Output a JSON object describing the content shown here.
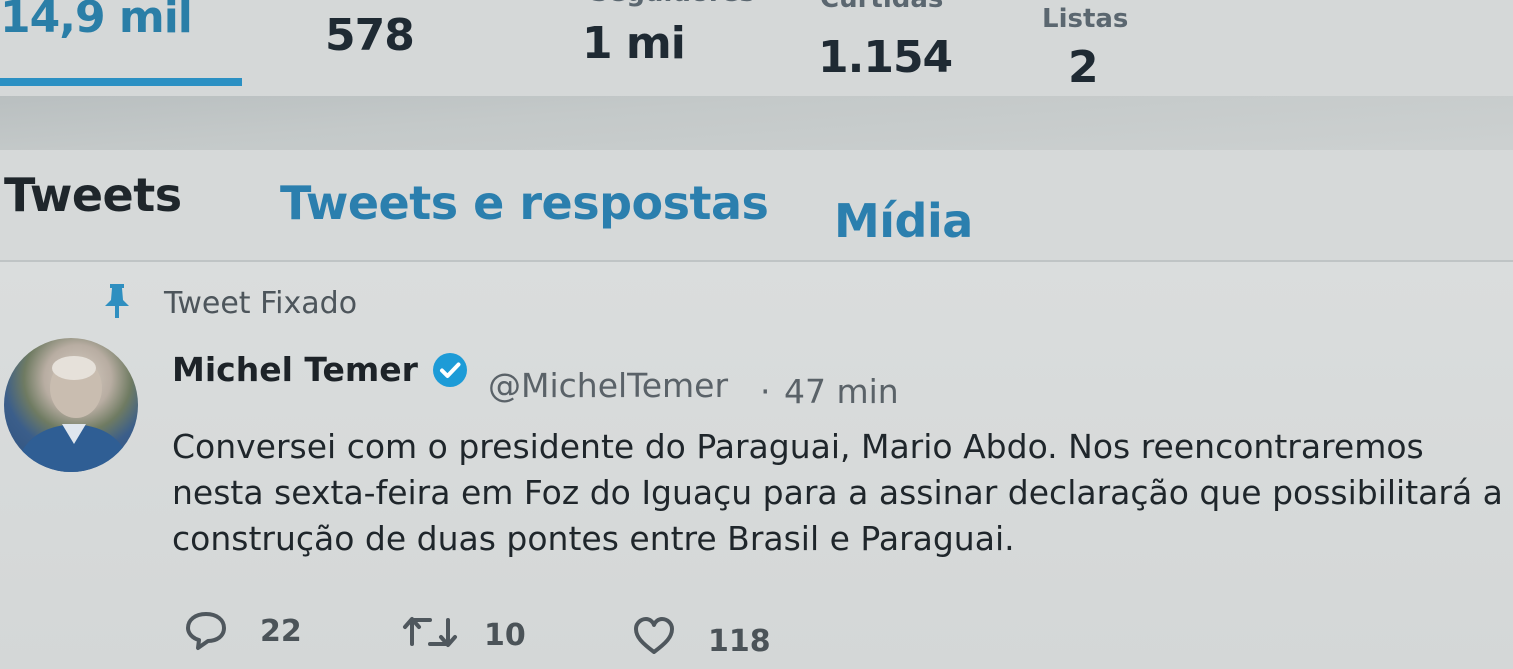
{
  "stats": {
    "tweets_value": "14,9 mil",
    "following_value": "578",
    "followers_label": "Seguidores",
    "followers_value": "1 mi",
    "likes_label": "Curtidas",
    "likes_value": "1.154",
    "lists_label": "Listas",
    "lists_value": "2"
  },
  "tabs": {
    "tweets": "Tweets",
    "replies": "Tweets e respostas",
    "media": "Mídia"
  },
  "tweet": {
    "pinned_label": "Tweet Fixado",
    "author_name": "Michel Temer",
    "handle": "@MichelTemer",
    "separator": "·",
    "time": "47 min",
    "text_lines": [
      "Conversei com o presidente do Paraguai, Mario Abdo. Nos reencontraremos",
      "nesta sexta-feira em Foz do Iguaçu para a assinar declaração que possibilitará a",
      "construção de duas pontes entre Brasil e Paraguai."
    ],
    "reply_count": "22",
    "retweet_count": "10",
    "like_count": "118"
  },
  "colors": {
    "accent": "#2b7fae",
    "underline": "#2b90c3",
    "verified": "#1d9bd7"
  },
  "icons": [
    "pin-icon",
    "verified-icon",
    "reply-icon",
    "retweet-icon",
    "like-icon"
  ]
}
